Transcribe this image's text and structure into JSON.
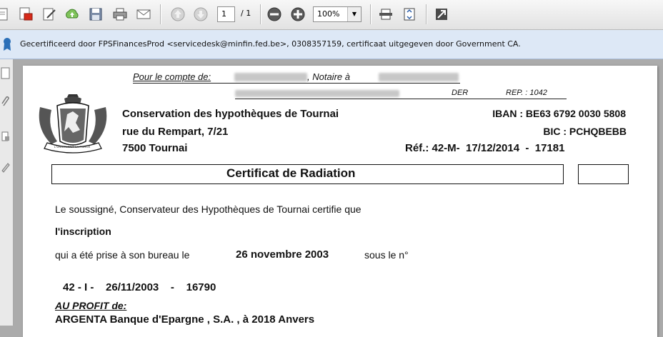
{
  "toolbar": {
    "page_current": "1",
    "page_total": "/ 1",
    "zoom": "100%",
    "icons": [
      "pages-icon",
      "export-pdf-icon",
      "edit-sign-icon",
      "upload-icon",
      "save-icon",
      "print-icon",
      "email-icon",
      "previous-page-icon",
      "next-page-icon",
      "zoom-out-icon",
      "zoom-in-icon",
      "fit-width-icon",
      "fit-page-icon",
      "fullscreen-icon"
    ]
  },
  "cert_bar": {
    "text": "Gecertificeerd door FPSFinancesProd <servicedesk@minfin.fed.be>, 0308357159, certificaat uitgegeven door Government CA."
  },
  "document": {
    "account_label": "Pour le compte de:",
    "account_suffix": ", Notaire à",
    "der_label": "DER",
    "rep_label": "REP. : 1042",
    "office_line1": "Conservation des hypothèques de Tournai",
    "office_line2": "rue du Rempart, 7/21",
    "office_line3": "7500 Tournai",
    "iban": "IBAN : BE63 6792 0030 5808",
    "bic": "BIC : PCHQBEBB",
    "ref": "Réf.: 42-M-  17/12/2014  -  17181",
    "title": "Certificat de Radiation",
    "para1": "Le soussigné, Conservateur des Hypothèques de Tournai certifie que",
    "inscription": "l'inscription",
    "para2": "qui a été prise à son bureau le",
    "date_prise": "26 novembre 2003",
    "sous_le_n": "sous le n°",
    "number_line": "42 - I -    26/11/2003    -    16790",
    "au_profit": "AU PROFIT de:",
    "beneficiary": "ARGENTA  Banque d'Epargne , S.A. , à 2018 Anvers",
    "seal_motto": "L'UNION FAIT LA FORCE"
  },
  "colors": {
    "cert_bar_bg": "#dde8f6",
    "toolbar_bg": "#ececec",
    "viewer_bg": "#ababab"
  }
}
